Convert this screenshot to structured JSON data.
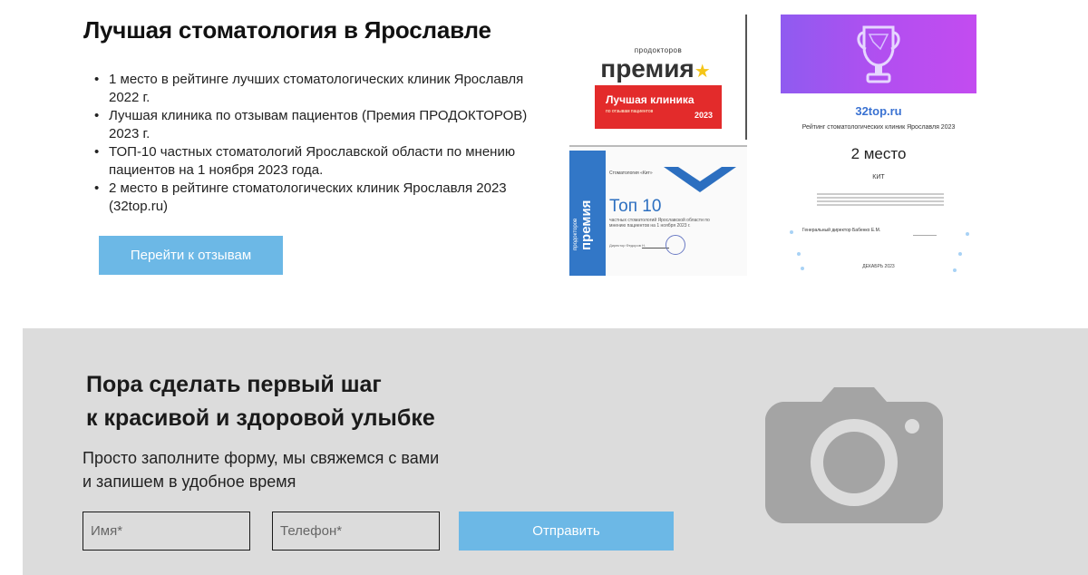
{
  "hero": {
    "title": "Лучшая стоматология в Ярославле",
    "bullets": [
      "1 место в рейтинге лучших стоматологических клиник Ярославля 2022 г.",
      "Лучшая клиника по отзывам пациентов (Премия ПРОДОКТОРОВ) 2023 г.",
      "ТОП-10 частных стоматологий Ярославской области по мнению пациентов на 1 ноября 2023 года.",
      "2 место в рейтинге стоматологических клиник Ярославля 2023 (32top.ru)"
    ],
    "reviews_button": "Перейти к отзывам"
  },
  "awards": {
    "prodoctorov": {
      "brand_small": "продокторов",
      "brand_big": "премия",
      "badge": "Лучшая клиника",
      "badge_sub": "по отзывам пациентов",
      "year": "2023"
    },
    "top10": {
      "vertical_small": "продокторов",
      "vertical_big": "премия",
      "clinic": "Стоматология «Кит»",
      "title": "Топ 10",
      "subtitle": "частных стоматологий Ярославской области по мнению пациентов на 1 ноября 2023 г.",
      "director": "Директор Федоров Н."
    },
    "top32": {
      "site": "32top.ru",
      "rating_title": "Рейтинг стоматологических клиник Ярославля 2023",
      "place": "2 место",
      "clinic": "КИТ",
      "director": "Генеральный директор Бабенко Е.М.",
      "date": "ДЕКАБРЬ 2023"
    }
  },
  "form": {
    "title_line1": "Пора сделать первый шаг",
    "title_line2": "к красивой и здоровой улыбке",
    "subtitle": "Просто заполните форму, мы свяжемся с вами и запишем в удобное время",
    "name_placeholder": "Имя*",
    "phone_placeholder": "Телефон*",
    "submit_label": "Отправить"
  },
  "icons": {
    "award_image": "award-certificate",
    "placeholder_image": "camera-icon"
  },
  "colors": {
    "accent_button": "#6cb8e6",
    "form_background": "#dcdcdc",
    "prodoctorov_red": "#e32b2b",
    "top10_blue": "#2c6fc0"
  }
}
